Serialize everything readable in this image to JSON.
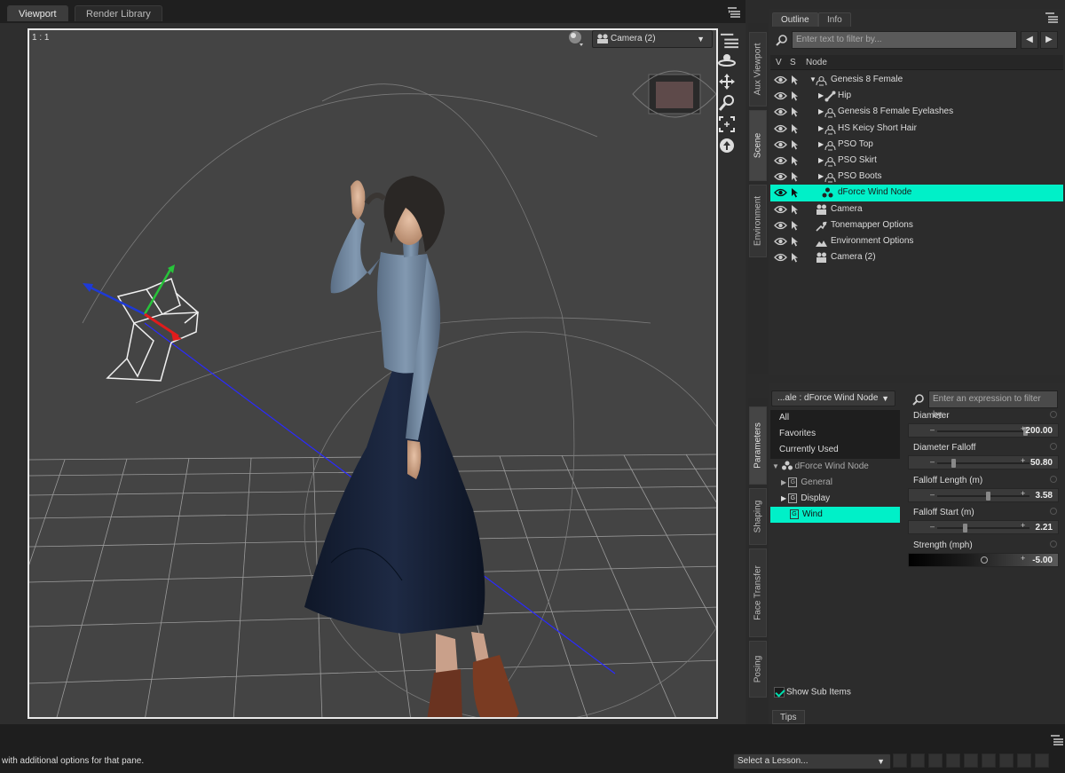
{
  "top_tabs": {
    "viewport": "Viewport",
    "render_library": "Render Library"
  },
  "viewport": {
    "scale_label": "1 : 1",
    "camera_select": "Camera (2)"
  },
  "side_tabs_top": {
    "aux": "Aux Viewport",
    "scene": "Scene",
    "environment": "Environment"
  },
  "side_tabs_bottom": {
    "parameters": "Parameters",
    "shaping": "Shaping",
    "face_transfer": "Face Transfer",
    "posing": "Posing"
  },
  "outline": {
    "tab_outline": "Outline",
    "tab_info": "Info",
    "filter_placeholder": "Enter text to filter by...",
    "col_v": "V",
    "col_s": "S",
    "col_node": "Node",
    "rows": [
      {
        "label": "Genesis 8 Female",
        "level": 0,
        "expand": "▼",
        "icon": "figure-icon"
      },
      {
        "label": "Hip",
        "level": 1,
        "expand": "▶",
        "icon": "bone-icon"
      },
      {
        "label": "Genesis 8 Female Eyelashes",
        "level": 1,
        "expand": "▶",
        "icon": "figure-icon"
      },
      {
        "label": "HS Keicy Short Hair",
        "level": 1,
        "expand": "▶",
        "icon": "figure-icon"
      },
      {
        "label": "PSO Top",
        "level": 1,
        "expand": "▶",
        "icon": "figure-icon"
      },
      {
        "label": "PSO Skirt",
        "level": 1,
        "expand": "▶",
        "icon": "figure-icon"
      },
      {
        "label": "PSO Boots",
        "level": 1,
        "expand": "▶",
        "icon": "figure-icon"
      },
      {
        "label": "dForce Wind Node",
        "level": 1,
        "expand": "",
        "icon": "wind-node-icon",
        "selected": true
      },
      {
        "label": "Camera",
        "level": 0,
        "expand": "",
        "icon": "camera-icon"
      },
      {
        "label": "Tonemapper Options",
        "level": 0,
        "expand": "",
        "icon": "tonemapper-icon"
      },
      {
        "label": "Environment Options",
        "level": 0,
        "expand": "",
        "icon": "environment-icon"
      },
      {
        "label": "Camera (2)",
        "level": 0,
        "expand": "",
        "icon": "camera-icon"
      }
    ]
  },
  "params": {
    "node_select": "...ale : dForce Wind Node",
    "filter_placeholder": "Enter an expression to filter by...",
    "categories": {
      "all": "All",
      "favorites": "Favorites",
      "currently_used": "Currently Used",
      "node": "dForce Wind Node",
      "general": "General",
      "display": "Display",
      "wind": "Wind"
    },
    "group_letter": "G",
    "properties": [
      {
        "name": "Diameter",
        "value": "200.00",
        "fraction": 0.95
      },
      {
        "name": "Diameter Falloff",
        "value": "50.80",
        "fraction": 0.17
      },
      {
        "name": "Falloff Length (m)",
        "value": "3.58",
        "fraction": 0.55
      },
      {
        "name": "Falloff Start (m)",
        "value": "2.21",
        "fraction": 0.3
      },
      {
        "name": "Strength (mph)",
        "value": "-5.00",
        "fraction": 0.49,
        "gradient": true
      }
    ],
    "show_sub_items": "Show Sub Items"
  },
  "tips_tab": "Tips",
  "status": {
    "text": "with additional options for that pane.",
    "lesson_select": "Select a Lesson..."
  },
  "colors": {
    "selection": "#00f0c8",
    "panel": "#2c2c2c",
    "viewport_bg": "#444444"
  }
}
